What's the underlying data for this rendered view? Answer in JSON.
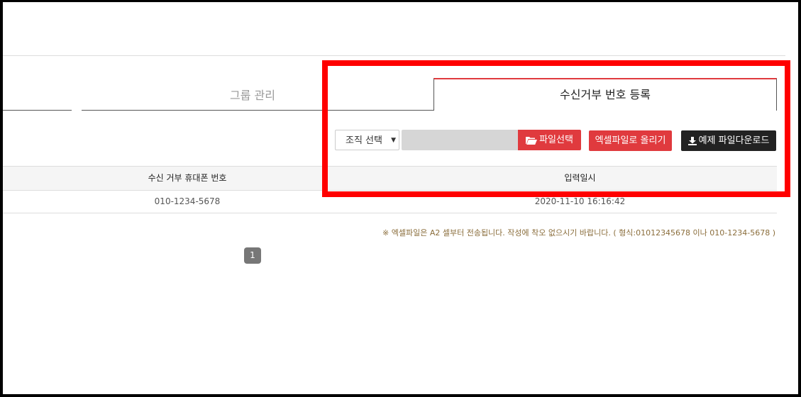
{
  "tabs": {
    "group": "그룹 관리",
    "active": "수신거부 번호 등록"
  },
  "controls": {
    "select_value": "조직 선택",
    "file_button": "파일선택",
    "excel_upload_button": "엑셀파일로 올리기",
    "sample_download_button": "예제 파일다운로드"
  },
  "table": {
    "headers": [
      "수신 거부 휴대폰 번호",
      "입력일시"
    ],
    "rows": [
      [
        "010-1234-5678",
        "2020-11-10 16:16:42"
      ]
    ]
  },
  "notice": "※ 엑셀파일은 A2 셀부터 전송됩니다. 작성에 착오 없으시기 바랍니다. ( 형식:01012345678 이나 010-1234-5678 )",
  "pagination": {
    "current": "1"
  },
  "colors": {
    "accent": "#e03a3e",
    "highlight": "#ff0000",
    "dark_button": "#222222"
  },
  "icons": {
    "file_button": "folder-open-icon",
    "download_button": "download-icon",
    "select": "caret-down-icon"
  }
}
